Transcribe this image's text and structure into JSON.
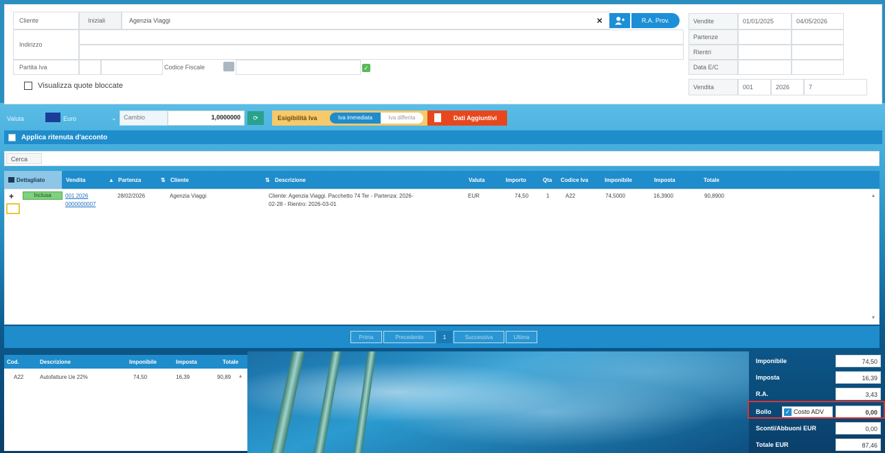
{
  "client": {
    "label": "Cliente",
    "search_mode": "Iniziali",
    "value": "Agenzia Viaggi",
    "clear_glyph": "✕",
    "ra_button": "R.A. Prov."
  },
  "address": {
    "label": "Indirizzo"
  },
  "tax": {
    "partita_iva_label": "Partita Iva",
    "codice_fiscale_label": "Codice Fiscale"
  },
  "show_locked": "Visualizza quote bloccate",
  "right_panel": {
    "vendite_label": "Vendite",
    "date_from": "01/01/2025",
    "date_to": "04/05/2026",
    "partenze_label": "Partenze",
    "rientri_label": "Rientri",
    "data_ec_label": "Data E/C",
    "vendita_label": "Vendita",
    "vendita_code": "001",
    "vendita_year": "2026",
    "vendita_num": "7"
  },
  "toolbar": {
    "valuta_label": "Valuta",
    "currency": "Euro",
    "cambio_label": "Cambio",
    "cambio_value": "1,0000000",
    "esigibilita_label": "Esigibilità Iva",
    "iva_immediata": "Iva immediata",
    "iva_differita": "Iva differita",
    "dati_aggiuntivi": "Dati Aggiuntivi"
  },
  "ritenuta": "Applica ritenuta d'acconto",
  "cerca": "Cerca",
  "grid": {
    "headers": [
      "Dettagliato",
      "Vendita",
      "Partenza",
      "Cliente",
      "Descrizione",
      "Valuta",
      "Importo",
      "Qta",
      "Codice Iva",
      "Imponibile",
      "Imposta",
      "Totale"
    ],
    "row": {
      "status": "Inclusa",
      "vendita_line1": "001 2026",
      "vendita_line2": "0000000007",
      "partenza": "28/02/2026",
      "cliente": "Agenzia Viaggi",
      "descrizione_line1": "Cliente: Agenzia Viaggi. Pacchetto 74 Ter - Partenza: 2026-",
      "descrizione_line2": "02-28 - Rientro: 2026-03-01",
      "valuta": "EUR",
      "importo": "74,50",
      "qta": "1",
      "codice_iva": "A22",
      "imponibile": "74,5000",
      "imposta": "16,3900",
      "totale": "90,8900"
    }
  },
  "pager": {
    "first": "Prima",
    "prev": "Precedente",
    "current": "1",
    "next": "Successiva",
    "last": "Ultima"
  },
  "iva_summary": {
    "headers": [
      "Cod.",
      "Descrizione",
      "Imponibile",
      "Imposta",
      "Totale"
    ],
    "rows": [
      {
        "cod": "A22",
        "desc": "Autofatture Ue 22%",
        "imponibile": "74,50",
        "imposta": "16,39",
        "totale": "90,89"
      }
    ]
  },
  "totals": {
    "imponibile_label": "Imponibile",
    "imponibile": "74,50",
    "imposta_label": "Imposta",
    "imposta": "16,39",
    "ra_label": "R.A.",
    "ra": "3,43",
    "bollo_label": "Bollo",
    "costo_adv_label": "Costo ADV",
    "bollo": "0,00",
    "sconti_label": "Sconti/Abbuoni EUR",
    "sconti": "0,00",
    "totale_label": "Totale EUR",
    "totale": "87,46"
  }
}
